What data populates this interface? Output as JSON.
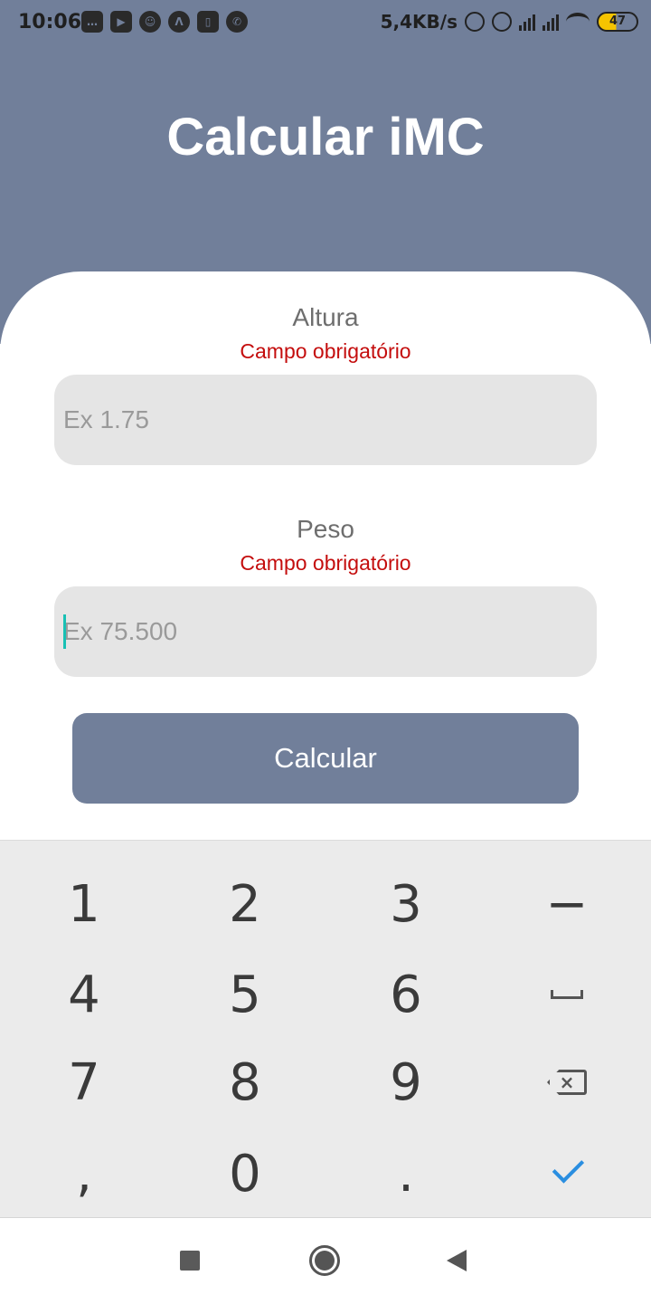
{
  "status_bar": {
    "time": "10:06",
    "left_icons": [
      "message-icon",
      "youtube-icon",
      "snapchat-icon",
      "arc-icon",
      "sim-icon",
      "whatsapp-icon"
    ],
    "network_speed": "5,4KB/s",
    "right_icons": [
      "bell-off-icon",
      "alarm-icon",
      "signal-icon",
      "signal-icon",
      "wifi-icon"
    ],
    "battery_level": "47"
  },
  "header": {
    "title": "Calcular iMC"
  },
  "form": {
    "height": {
      "label": "Altura",
      "error": "Campo obrigatório",
      "placeholder": "Ex 1.75",
      "value": ""
    },
    "weight": {
      "label": "Peso",
      "error": "Campo obrigatório",
      "placeholder": "Ex 75.500",
      "value": ""
    },
    "submit_label": "Calcular"
  },
  "keyboard": {
    "keys": [
      "1",
      "2",
      "3",
      "−",
      "4",
      "5",
      "6",
      "space",
      "7",
      "8",
      "9",
      "backspace",
      ",",
      "0",
      ".",
      "done"
    ],
    "row1": [
      "1",
      "2",
      "3",
      "−"
    ],
    "row2": [
      "4",
      "5",
      "6"
    ],
    "row3": [
      "7",
      "8",
      "9"
    ],
    "row4": [
      ",",
      "0",
      "."
    ],
    "done_color": "#2a8ee0"
  },
  "colors": {
    "header_bg": "#717f9a",
    "button_bg": "#717f9a",
    "error": "#c40d0d",
    "input_bg": "#e5e5e5",
    "cursor": "#18c0b4"
  },
  "nav_bar": {
    "icons": [
      "recents-icon",
      "home-icon",
      "back-icon"
    ]
  }
}
